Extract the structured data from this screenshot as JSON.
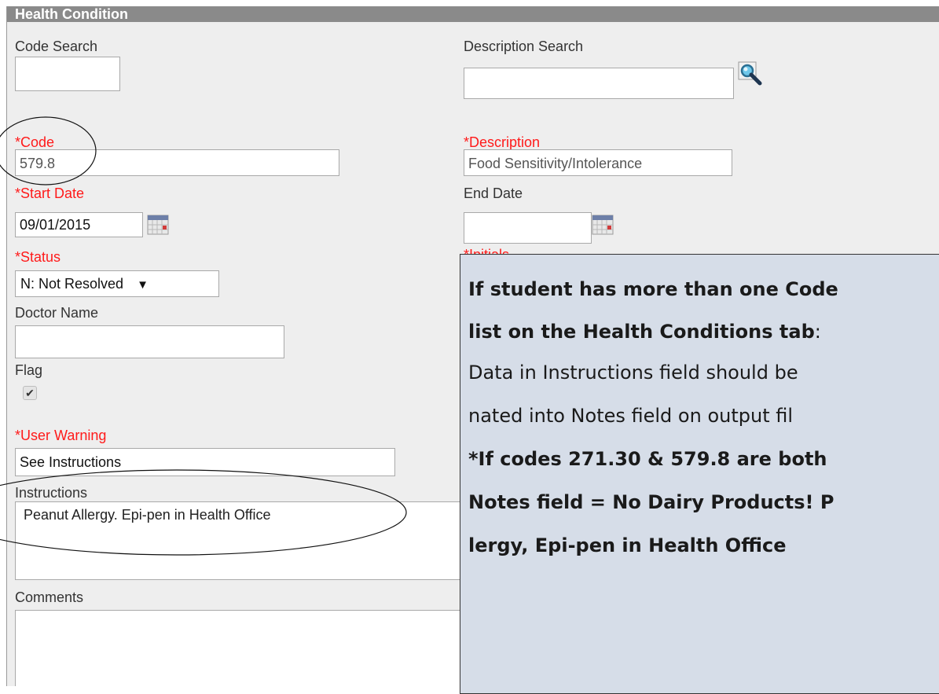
{
  "panel": {
    "title": "Health Condition",
    "code_search_label": "Code Search",
    "description_search_label": "Description Search",
    "code_label": "*Code",
    "code_value": "579.8",
    "description_label": "*Description",
    "description_value": "Food Sensitivity/Intolerance",
    "start_date_label": "*Start Date",
    "start_date_value": "09/01/2015",
    "end_date_label": "End Date",
    "end_date_value": "",
    "status_label": "*Status",
    "status_value": "N: Not Resolved",
    "status_arrow": "▼",
    "initials_label": "*Initials",
    "doctor_name_label": "Doctor Name",
    "flag_label": "Flag",
    "flag_checked": true,
    "user_warning_label": "*User Warning",
    "user_warning_value": "See Instructions",
    "instructions_label": "Instructions",
    "instructions_value": "Peanut Allergy. Epi-pen in Health Office",
    "comments_label": "Comments",
    "comments_value": ""
  },
  "callout": {
    "line1": "If student has more than one Code",
    "line2a": "list on the Health Conditions tab",
    "line2b": ":",
    "line3": "Data in Instructions field should be",
    "line4": "nated into Notes field on output fil",
    "line5": "*If codes 271.30 & 579.8 are both",
    "line6": "Notes field = No Dairy Products!  P",
    "line7": "lergy, Epi-pen in Health Office"
  },
  "icons": {
    "search": "magnifier-icon",
    "calendar": "calendar-icon",
    "checkbox": "check-icon"
  },
  "colors": {
    "title_bar": "#8a8a8a",
    "required_label": "#ff1a1a",
    "callout_bg": "#d6dde8"
  }
}
